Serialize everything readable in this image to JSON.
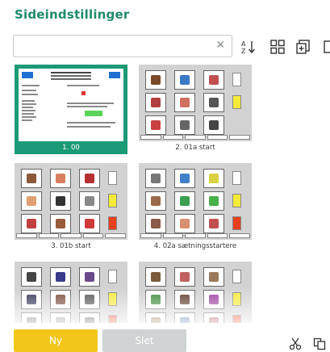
{
  "header": {
    "title": "Sideindstillinger"
  },
  "search": {
    "value": "",
    "placeholder": ""
  },
  "toolbar": {
    "icons": [
      "clear-icon",
      "sort-az-icon",
      "grid-view-icon",
      "add-page-icon",
      "page-icon"
    ]
  },
  "pages": [
    {
      "caption": "1. 00",
      "selected": true,
      "kind": "document"
    },
    {
      "caption": "2. 01a start",
      "selected": false,
      "kind": "grid"
    },
    {
      "caption": "3. 01b start",
      "selected": false,
      "kind": "grid"
    },
    {
      "caption": "4. 02a sætningsstartere",
      "selected": false,
      "kind": "grid"
    },
    {
      "caption": "",
      "selected": false,
      "kind": "grid"
    },
    {
      "caption": "",
      "selected": false,
      "kind": "grid"
    }
  ],
  "actions": {
    "new_label": "Ny",
    "delete_label": "Slet"
  },
  "colors": {
    "accent": "#1a9a76",
    "title": "#1e8a6a",
    "new_button": "#f2c71a",
    "delete_button": "#cfd3d3"
  }
}
